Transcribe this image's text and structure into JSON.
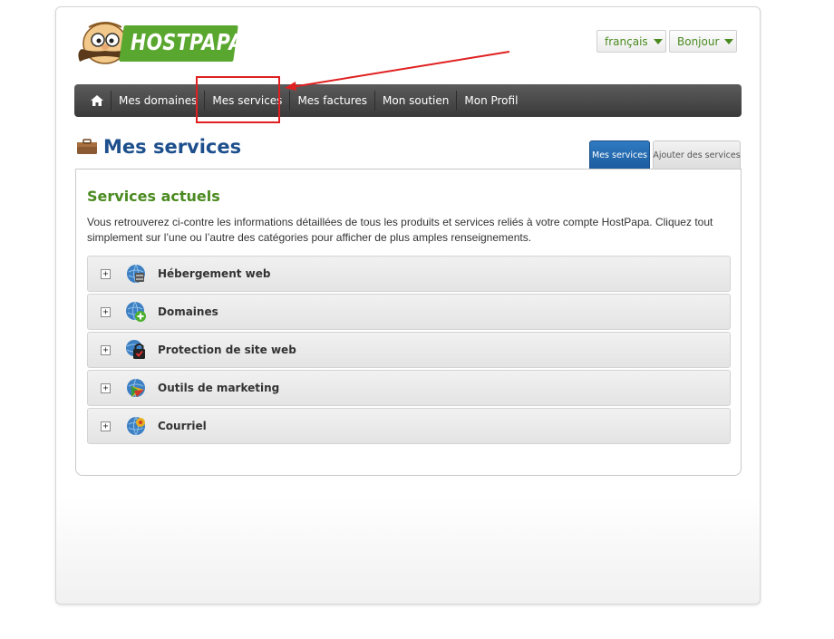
{
  "logo": {
    "text": "HOSTPAPA"
  },
  "top_bar": {
    "language": "français",
    "user": "Bonjour"
  },
  "nav": {
    "items": [
      "Mes domaines",
      "Mes services",
      "Mes factures",
      "Mon soutien",
      "Mon Profil"
    ]
  },
  "page": {
    "title": "Mes services"
  },
  "tabs": {
    "active": "Mes services",
    "inactive": "Ajouter des services"
  },
  "section": {
    "title": "Services actuels",
    "intro": "Vous retrouverez ci-contre les informations détaillées de tous les produits et services reliés à votre compte HostPapa. Cliquez tout simplement sur l’une ou l’autre des catégories pour afficher de plus amples renseignements."
  },
  "categories": [
    {
      "label": "Hébergement web",
      "icon": "server-globe-icon"
    },
    {
      "label": "Domaines",
      "icon": "globe-add-icon"
    },
    {
      "label": "Protection de site web",
      "icon": "lock-shield-icon"
    },
    {
      "label": "Outils de marketing",
      "icon": "marketing-globe-icon"
    },
    {
      "label": "Courriel",
      "icon": "email-globe-icon"
    }
  ],
  "colors": {
    "brand_green": "#5aa72f",
    "title_blue": "#1d4f8c",
    "tab_blue": "#2f7bc2",
    "annotation_red": "#e02020"
  }
}
